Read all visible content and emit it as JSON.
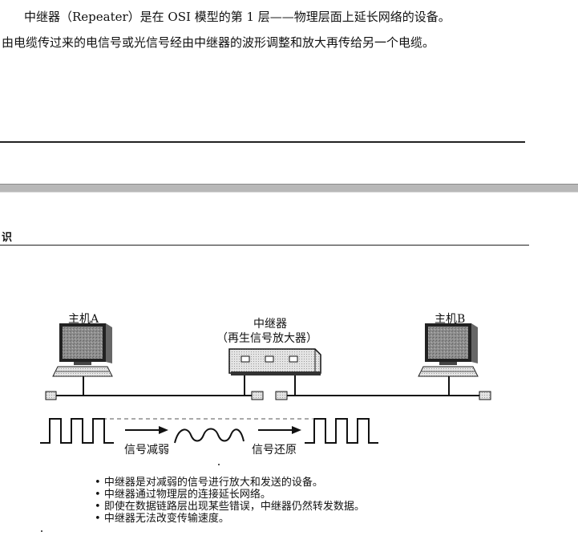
{
  "intro": {
    "line1": "中继器（Repeater）是在 OSI 模型的第 1 层——物理层面上延长网络的设备。",
    "line2": "由电缆传过来的电信号或光信号经由中继器的波形调整和放大再传给另一个电缆。"
  },
  "section": {
    "header_fragment": "识"
  },
  "diagram": {
    "host_a_label": "主机A",
    "repeater_label": "中继器",
    "repeater_sublabel": "（再生信号放大器）",
    "host_b_label": "主机B",
    "attenuation_label": "信号减弱",
    "restore_label": "信号还原"
  },
  "bullets": [
    "中继器是对减弱的信号进行放大和发送的设备。",
    "中继器通过物理层的连接延长网络。",
    "即使在数据链路层出现某些错误，中继器仍然转发数据。",
    "中继器无法改变传输速度。"
  ]
}
